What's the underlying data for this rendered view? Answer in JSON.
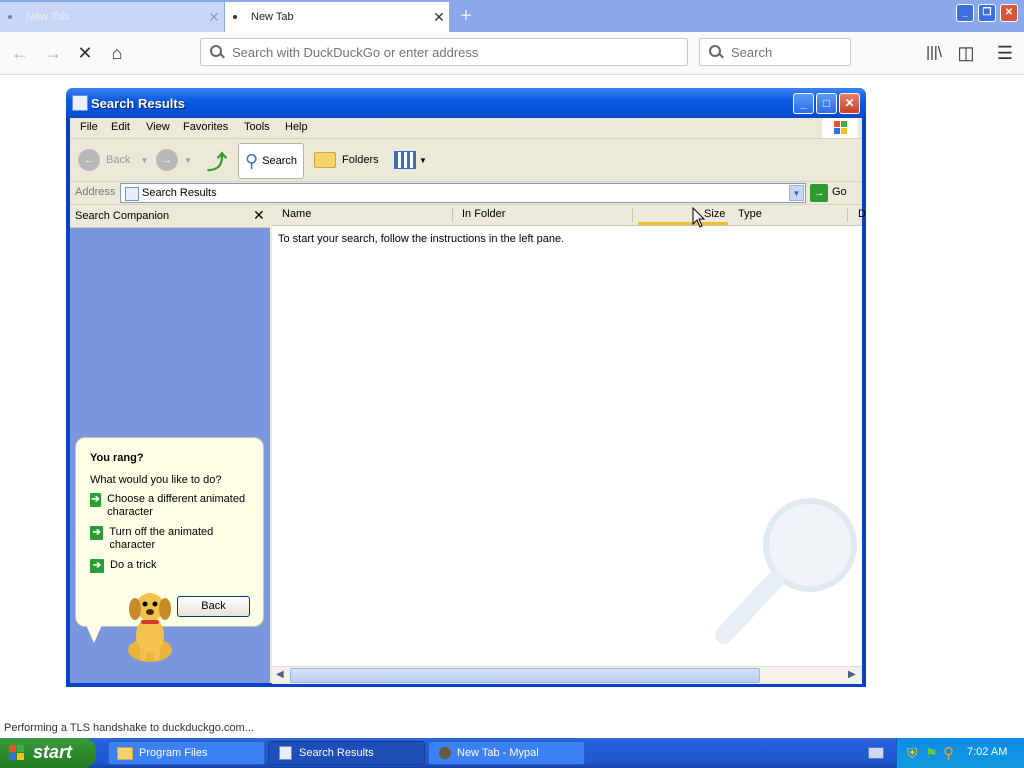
{
  "browser": {
    "tabs": [
      {
        "label": "New Tab"
      },
      {
        "label": "New Tab"
      }
    ],
    "url_placeholder": "Search with DuckDuckGo or enter address",
    "search_placeholder": "Search",
    "status_text": "Performing a TLS handshake to duckduckgo.com..."
  },
  "explorer": {
    "title": "Search Results",
    "menu": [
      "File",
      "Edit",
      "View",
      "Favorites",
      "Tools",
      "Help"
    ],
    "toolbar": {
      "back": "Back",
      "search": "Search",
      "folders": "Folders"
    },
    "address_label": "Address",
    "address_value": "Search Results",
    "go_label": "Go",
    "companion_title": "Search Companion",
    "balloon": {
      "heading": "You rang?",
      "prompt": "What would you like to do?",
      "options": [
        {
          "label": "Choose a different animated character"
        },
        {
          "label": "Turn off the animated character"
        },
        {
          "label": "Do a trick"
        }
      ],
      "back_button": "Back"
    },
    "columns": [
      "Name",
      "In Folder",
      "Size",
      "Type",
      "D"
    ],
    "empty_message": "To start your search, follow the instructions in the left pane."
  },
  "taskbar": {
    "start_label": "start",
    "tasks": [
      {
        "label": "Program Files"
      },
      {
        "label": "Search Results"
      },
      {
        "label": "New Tab - Mypal"
      }
    ],
    "clock": "7:02 AM"
  }
}
